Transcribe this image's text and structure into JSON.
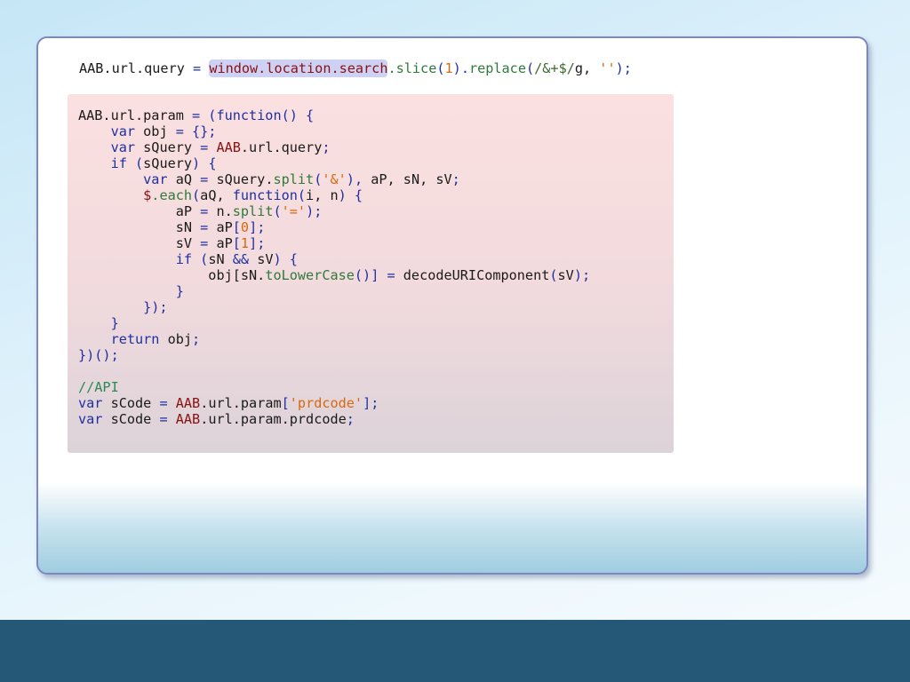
{
  "query_line": [
    {
      "t": "AAB.url.query ",
      "c": "plain"
    },
    {
      "t": "= ",
      "c": "k"
    },
    {
      "t": "window.location.search",
      "c": "obj",
      "hl": true
    },
    {
      "t": ".slice",
      "c": "fn"
    },
    {
      "t": "(",
      "c": "k"
    },
    {
      "t": "1",
      "c": "num"
    },
    {
      "t": ").",
      "c": "k"
    },
    {
      "t": "replace",
      "c": "fn"
    },
    {
      "t": "(",
      "c": "k"
    },
    {
      "t": "/&+$/",
      "c": "re"
    },
    {
      "t": "g, ",
      "c": "plain"
    },
    {
      "t": "''",
      "c": "str"
    },
    {
      "t": ");",
      "c": "k"
    }
  ],
  "code_lines": [
    [
      {
        "t": "AAB.url.param ",
        "c": "plain"
      },
      {
        "t": "= (function() {",
        "c": "k"
      }
    ],
    [
      {
        "t": "    var ",
        "c": "k"
      },
      {
        "t": "obj ",
        "c": "plain"
      },
      {
        "t": "= {};",
        "c": "k"
      }
    ],
    [
      {
        "t": "    var ",
        "c": "k"
      },
      {
        "t": "sQuery ",
        "c": "plain"
      },
      {
        "t": "= ",
        "c": "k"
      },
      {
        "t": "AAB",
        "c": "obj"
      },
      {
        "t": ".url.query",
        "c": "plain"
      },
      {
        "t": ";",
        "c": "k"
      }
    ],
    [
      {
        "t": "    if (",
        "c": "k"
      },
      {
        "t": "sQuery",
        "c": "plain"
      },
      {
        "t": ") {",
        "c": "k"
      }
    ],
    [
      {
        "t": "        var ",
        "c": "k"
      },
      {
        "t": "aQ ",
        "c": "plain"
      },
      {
        "t": "= ",
        "c": "k"
      },
      {
        "t": "sQuery.",
        "c": "plain"
      },
      {
        "t": "split",
        "c": "fn"
      },
      {
        "t": "(",
        "c": "k"
      },
      {
        "t": "'&'",
        "c": "str"
      },
      {
        "t": "), ",
        "c": "k"
      },
      {
        "t": "aP, sN, sV",
        "c": "plain"
      },
      {
        "t": ";",
        "c": "k"
      }
    ],
    [
      {
        "t": "        $",
        "c": "obj"
      },
      {
        "t": ".each",
        "c": "fn"
      },
      {
        "t": "(",
        "c": "k"
      },
      {
        "t": "aQ, ",
        "c": "plain"
      },
      {
        "t": "function(",
        "c": "k"
      },
      {
        "t": "i, n",
        "c": "plain"
      },
      {
        "t": ") {",
        "c": "k"
      }
    ],
    [
      {
        "t": "            aP ",
        "c": "plain"
      },
      {
        "t": "= ",
        "c": "k"
      },
      {
        "t": "n.",
        "c": "plain"
      },
      {
        "t": "split",
        "c": "fn"
      },
      {
        "t": "(",
        "c": "k"
      },
      {
        "t": "'='",
        "c": "str"
      },
      {
        "t": ");",
        "c": "k"
      }
    ],
    [
      {
        "t": "            sN ",
        "c": "plain"
      },
      {
        "t": "= ",
        "c": "k"
      },
      {
        "t": "aP",
        "c": "plain"
      },
      {
        "t": "[",
        "c": "k"
      },
      {
        "t": "0",
        "c": "num"
      },
      {
        "t": "];",
        "c": "k"
      }
    ],
    [
      {
        "t": "            sV ",
        "c": "plain"
      },
      {
        "t": "= ",
        "c": "k"
      },
      {
        "t": "aP",
        "c": "plain"
      },
      {
        "t": "[",
        "c": "k"
      },
      {
        "t": "1",
        "c": "num"
      },
      {
        "t": "];",
        "c": "k"
      }
    ],
    [
      {
        "t": "            if (",
        "c": "k"
      },
      {
        "t": "sN ",
        "c": "plain"
      },
      {
        "t": "&& ",
        "c": "k"
      },
      {
        "t": "sV",
        "c": "plain"
      },
      {
        "t": ") {",
        "c": "k"
      }
    ],
    [
      {
        "t": "                obj[sN.",
        "c": "plain"
      },
      {
        "t": "toLowerCase",
        "c": "fn"
      },
      {
        "t": "()] ",
        "c": "k"
      },
      {
        "t": "= ",
        "c": "k"
      },
      {
        "t": "decodeURIComponent",
        "c": "plain"
      },
      {
        "t": "(",
        "c": "k"
      },
      {
        "t": "sV",
        "c": "plain"
      },
      {
        "t": ");",
        "c": "k"
      }
    ],
    [
      {
        "t": "            }",
        "c": "k"
      }
    ],
    [
      {
        "t": "        });",
        "c": "k"
      }
    ],
    [
      {
        "t": "    }",
        "c": "k"
      }
    ],
    [
      {
        "t": "    return ",
        "c": "k"
      },
      {
        "t": "obj",
        "c": "plain"
      },
      {
        "t": ";",
        "c": "k"
      }
    ],
    [
      {
        "t": "})();",
        "c": "k"
      }
    ],
    [],
    [
      {
        "t": "//API",
        "c": "cmt"
      }
    ],
    [
      {
        "t": "var ",
        "c": "k"
      },
      {
        "t": "sCode ",
        "c": "plain"
      },
      {
        "t": "= ",
        "c": "k"
      },
      {
        "t": "AAB",
        "c": "obj"
      },
      {
        "t": ".url.param",
        "c": "plain"
      },
      {
        "t": "[",
        "c": "k"
      },
      {
        "t": "'prdcode'",
        "c": "str"
      },
      {
        "t": "];",
        "c": "k"
      }
    ],
    [
      {
        "t": "var ",
        "c": "k"
      },
      {
        "t": "sCode ",
        "c": "plain"
      },
      {
        "t": "= ",
        "c": "k"
      },
      {
        "t": "AAB",
        "c": "obj"
      },
      {
        "t": ".url.param.prdcode",
        "c": "plain"
      },
      {
        "t": ";",
        "c": "k"
      }
    ]
  ],
  "colors": {
    "background_top": "#c6e6f6",
    "panel_border": "#7f86c4",
    "code_block_bg": "#fbe0e0",
    "highlight_bg": "#cdd1f3",
    "bottom_bar": "#245876"
  }
}
